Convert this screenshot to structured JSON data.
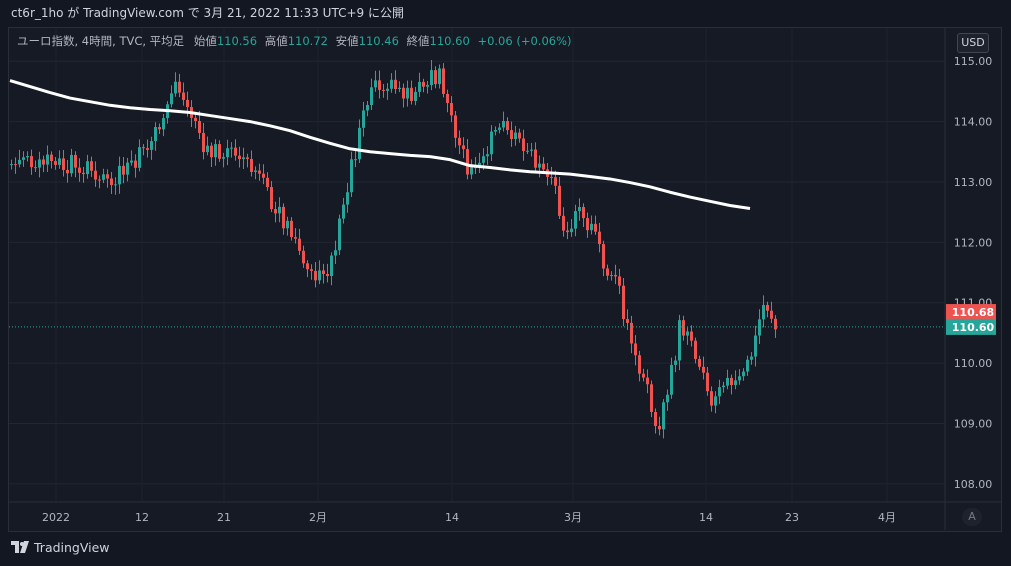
{
  "header": {
    "text": "ct6r_1ho が TradingView.com で 3月 21, 2022 11:33 UTC+9 に公開"
  },
  "legend": {
    "symbol": "ユーロ指数, 4時間, TVC, 平均足",
    "open_label": "始値",
    "open": "110.56",
    "high_label": "高値",
    "high": "110.72",
    "low_label": "安値",
    "low": "110.46",
    "close_label": "終値",
    "close": "110.60",
    "change": "+0.06 (+0.06%)"
  },
  "currency_button": "USD",
  "auto_button": "A",
  "brand": "TradingView",
  "colors": {
    "up": "#26a69a",
    "down": "#ef5350",
    "ma_line": "#ffffff",
    "background": "#161a25"
  },
  "chart_data": {
    "type": "candlestick",
    "y_ticks": [
      "108.00",
      "109.00",
      "110.00",
      "111.00",
      "112.00",
      "113.00",
      "114.00",
      "115.00"
    ],
    "ylim": [
      107.7,
      115.55
    ],
    "x_tick_labels": [
      "2022",
      "12",
      "21",
      "2月",
      "14",
      "3月",
      "14",
      "23",
      "4月"
    ],
    "price_labels": [
      {
        "value": 110.68,
        "text": "110.68",
        "color": "#ef5350"
      },
      {
        "value": 110.6,
        "text": "110.60",
        "color": "#26a69a"
      }
    ],
    "ma_series": [
      [
        0,
        114.68
      ],
      [
        20,
        114.58
      ],
      [
        40,
        114.48
      ],
      [
        60,
        114.39
      ],
      [
        80,
        114.33
      ],
      [
        100,
        114.27
      ],
      [
        120,
        114.23
      ],
      [
        140,
        114.2
      ],
      [
        160,
        114.18
      ],
      [
        180,
        114.15
      ],
      [
        200,
        114.1
      ],
      [
        220,
        114.05
      ],
      [
        240,
        114.0
      ],
      [
        260,
        113.93
      ],
      [
        280,
        113.85
      ],
      [
        300,
        113.74
      ],
      [
        320,
        113.64
      ],
      [
        340,
        113.55
      ],
      [
        360,
        113.5
      ],
      [
        380,
        113.47
      ],
      [
        400,
        113.44
      ],
      [
        420,
        113.42
      ],
      [
        440,
        113.37
      ],
      [
        460,
        113.27
      ],
      [
        480,
        113.24
      ],
      [
        500,
        113.2
      ],
      [
        520,
        113.17
      ],
      [
        540,
        113.15
      ],
      [
        560,
        113.13
      ],
      [
        580,
        113.09
      ],
      [
        600,
        113.05
      ],
      [
        620,
        112.99
      ],
      [
        640,
        112.92
      ],
      [
        660,
        112.83
      ],
      [
        680,
        112.75
      ],
      [
        700,
        112.68
      ],
      [
        720,
        112.61
      ],
      [
        740,
        112.56
      ]
    ],
    "candle_series": [
      {
        "from": 0,
        "to": 40,
        "start": 113.3,
        "end": 113.45,
        "wiggle": 0.2
      },
      {
        "from": 40,
        "to": 100,
        "start": 113.4,
        "end": 113.05,
        "wiggle": 0.18
      },
      {
        "from": 100,
        "to": 135,
        "start": 113.1,
        "end": 113.55,
        "wiggle": 0.2
      },
      {
        "from": 135,
        "to": 165,
        "start": 113.5,
        "end": 114.65,
        "wiggle": 0.15
      },
      {
        "from": 165,
        "to": 200,
        "start": 114.6,
        "end": 113.4,
        "wiggle": 0.2
      },
      {
        "from": 200,
        "to": 240,
        "start": 113.5,
        "end": 113.4,
        "wiggle": 0.15
      },
      {
        "from": 240,
        "to": 300,
        "start": 113.3,
        "end": 111.45,
        "wiggle": 0.18
      },
      {
        "from": 300,
        "to": 318,
        "start": 111.45,
        "end": 111.5,
        "wiggle": 0.1
      },
      {
        "from": 318,
        "to": 360,
        "start": 111.6,
        "end": 114.75,
        "wiggle": 0.18
      },
      {
        "from": 360,
        "to": 400,
        "start": 114.7,
        "end": 114.45,
        "wiggle": 0.15
      },
      {
        "from": 400,
        "to": 430,
        "start": 114.5,
        "end": 114.75,
        "wiggle": 0.2
      },
      {
        "from": 430,
        "to": 460,
        "start": 114.7,
        "end": 113.05,
        "wiggle": 0.2
      },
      {
        "from": 460,
        "to": 490,
        "start": 113.2,
        "end": 113.95,
        "wiggle": 0.15
      },
      {
        "from": 490,
        "to": 545,
        "start": 113.9,
        "end": 113.05,
        "wiggle": 0.15
      },
      {
        "from": 545,
        "to": 553,
        "start": 112.9,
        "end": 111.9,
        "wiggle": 0.25
      },
      {
        "from": 553,
        "to": 568,
        "start": 112.0,
        "end": 112.65,
        "wiggle": 0.15
      },
      {
        "from": 568,
        "to": 610,
        "start": 112.5,
        "end": 111.15,
        "wiggle": 0.2
      },
      {
        "from": 610,
        "to": 648,
        "start": 111.0,
        "end": 108.75,
        "wiggle": 0.2
      },
      {
        "from": 648,
        "to": 672,
        "start": 108.9,
        "end": 110.9,
        "wiggle": 0.2
      },
      {
        "from": 672,
        "to": 700,
        "start": 110.6,
        "end": 109.3,
        "wiggle": 0.2
      },
      {
        "from": 700,
        "to": 740,
        "start": 109.3,
        "end": 110.1,
        "wiggle": 0.15
      },
      {
        "from": 740,
        "to": 752,
        "start": 110.2,
        "end": 111.0,
        "wiggle": 0.2
      },
      {
        "from": 752,
        "to": 766,
        "start": 110.9,
        "end": 110.6,
        "wiggle": 0.15
      }
    ]
  }
}
